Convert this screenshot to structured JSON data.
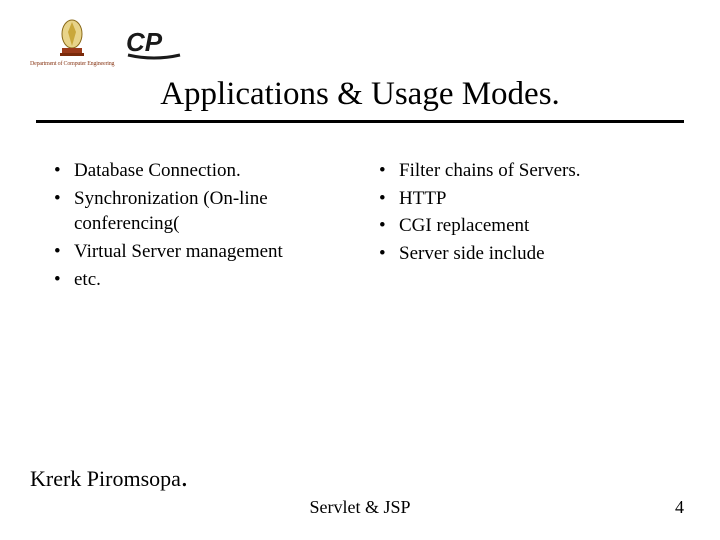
{
  "header": {
    "dept_label": "Department of Computer Engineering",
    "cp_label": "CP"
  },
  "title": "Applications & Usage Modes.",
  "left_list": [
    "Database Connection.",
    "Synchronization (On-line conferencing(",
    "Virtual Server management",
    "etc."
  ],
  "right_list": [
    "Filter chains of Servers.",
    "HTTP",
    "CGI replacement",
    "Server side include"
  ],
  "author": "Krerk Piromsopa",
  "footer_topic": "Servlet & JSP",
  "page_number": "4"
}
